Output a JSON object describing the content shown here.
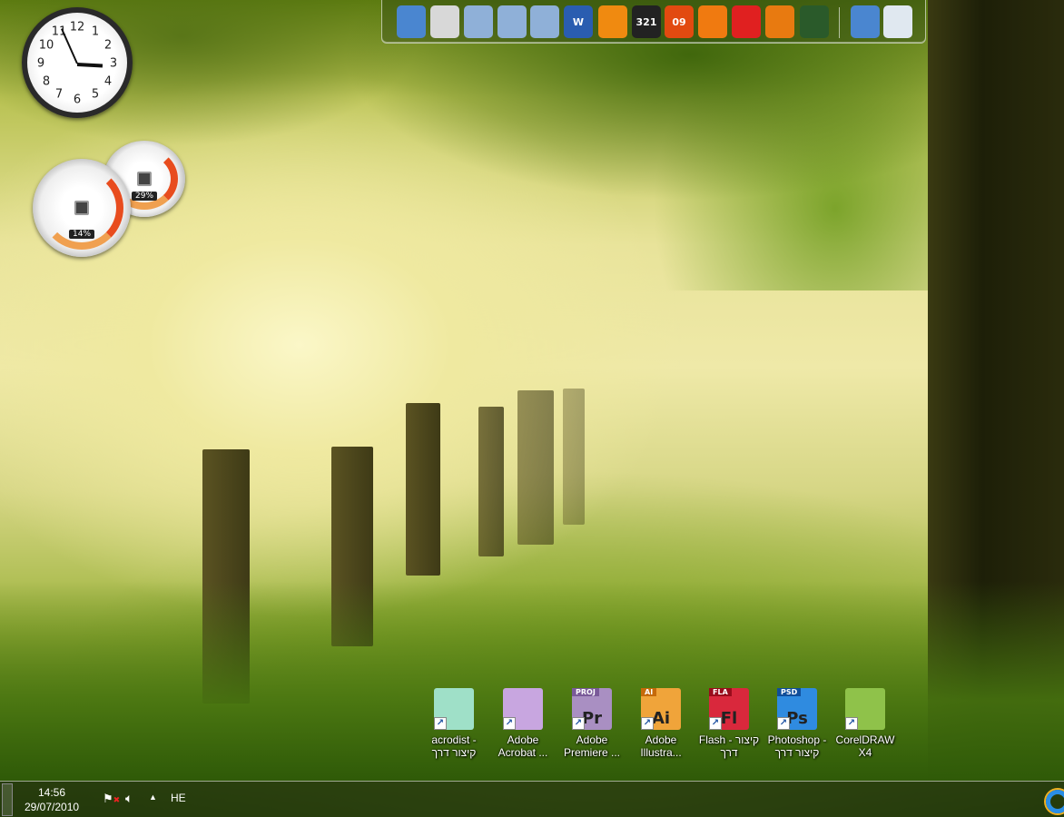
{
  "gadgets": {
    "clock": {
      "numerals": [
        "12",
        "1",
        "2",
        "3",
        "4",
        "5",
        "6",
        "7",
        "8",
        "9",
        "10",
        "11"
      ],
      "time": "14:56"
    },
    "cpu_meter": {
      "cpu_percent": "14%",
      "memory_percent": "29%"
    }
  },
  "dock": {
    "items": [
      {
        "name": "network-computer",
        "icon": "globe-computer-icon",
        "label": ""
      },
      {
        "name": "computer",
        "icon": "computer-icon",
        "label": ""
      },
      {
        "name": "documents-folder",
        "icon": "folder-icon",
        "label": ""
      },
      {
        "name": "music-folder",
        "icon": "music-folder-icon",
        "label": ""
      },
      {
        "name": "pictures-folder",
        "icon": "pictures-folder-icon",
        "label": ""
      },
      {
        "name": "word",
        "icon": "word-icon",
        "label": "W"
      },
      {
        "name": "vlc",
        "icon": "vlc-cone-icon",
        "label": ""
      },
      {
        "name": "media-player-classic",
        "icon": "clapperboard-icon",
        "label": "321"
      },
      {
        "name": "nero",
        "icon": "nero-icon",
        "label": "09"
      },
      {
        "name": "mail",
        "icon": "envelope-icon",
        "label": ""
      },
      {
        "name": "transfer",
        "icon": "up-down-arrow-icon",
        "label": ""
      },
      {
        "name": "firefox",
        "icon": "firefox-icon",
        "label": ""
      },
      {
        "name": "google-earth",
        "icon": "earth-icon",
        "label": ""
      }
    ],
    "right_items": [
      {
        "name": "internet",
        "icon": "globe-icon"
      },
      {
        "name": "recycle-bin",
        "icon": "recycle-bin-icon"
      }
    ]
  },
  "desktop_icons": [
    {
      "label": "acrodist - קיצור דרך",
      "tag": "",
      "glyph": "",
      "bg": "#9fe0c8"
    },
    {
      "label": "Adobe Acrobat ...",
      "tag": "",
      "glyph": "",
      "bg": "#c8a6e0"
    },
    {
      "label": "Adobe Premiere ...",
      "tag": "PROJ",
      "glyph": "Pr",
      "bg": "#a98fc2",
      "tagbg": "#7a5a99"
    },
    {
      "label": "Adobe Illustra...",
      "tag": "AI",
      "glyph": "Ai",
      "bg": "#f0a43a",
      "tagbg": "#c66a0a"
    },
    {
      "label": "Flash - קיצור דרך",
      "tag": "FLA",
      "glyph": "Fl",
      "bg": "#d9283c",
      "tagbg": "#9a0c1c"
    },
    {
      "label": "Photoshop - קיצור דרך",
      "tag": "PSD",
      "glyph": "Ps",
      "bg": "#2f8be0",
      "tagbg": "#104e9a"
    },
    {
      "label": "CorelDRAW X4",
      "tag": "",
      "glyph": "",
      "bg": "#8fc24a"
    }
  ],
  "taskbar": {
    "time": "14:56",
    "date": "29/07/2010",
    "language": "HE"
  }
}
